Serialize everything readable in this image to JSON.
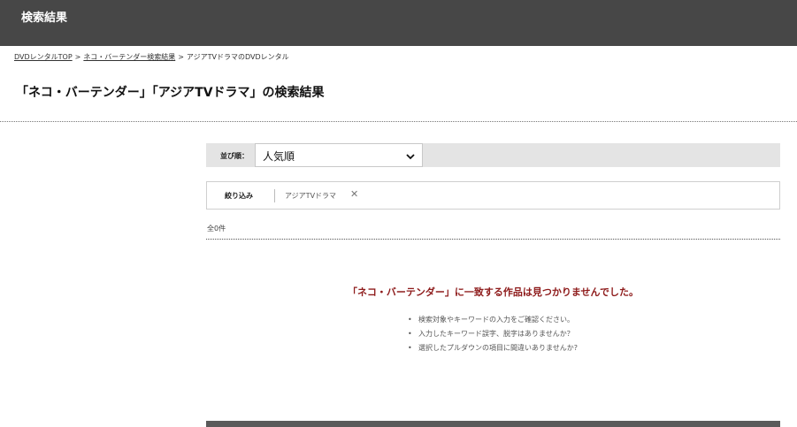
{
  "header": {
    "title": "検索結果"
  },
  "breadcrumb": {
    "items": [
      {
        "label": "DVDレンタルTOP",
        "link": true
      },
      {
        "label": "ネコ・バーテンダー検索結果",
        "link": true
      },
      {
        "label": "アジアTVドラマのDVDレンタル",
        "link": false
      }
    ],
    "separator": ">"
  },
  "page_title": "「ネコ・バーテンダー」「アジアTVドラマ」の検索結果",
  "sort": {
    "label": "並び順：",
    "selected": "人気順"
  },
  "filter": {
    "heading": "絞り込み",
    "chip_label": "アジアTVドラマ",
    "remove_glyph": "✕"
  },
  "result_count": "全0件",
  "no_result": {
    "message": "「ネコ・バーテンダー」に一致する作品は見つかりませんでした。",
    "tips": [
      "検索対象やキーワードの入力をご確認ください。",
      "入力したキーワード誤字、脱字はありませんか？",
      "選択したプルダウンの項目に間違いありませんか?"
    ]
  },
  "colors": {
    "header_bg": "#474747",
    "error_text": "#8e1b1b",
    "sort_bg": "#e4e4e4"
  }
}
